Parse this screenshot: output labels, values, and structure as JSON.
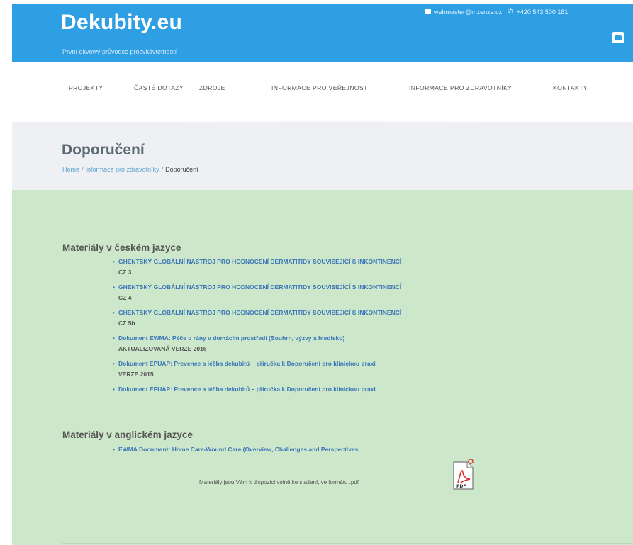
{
  "header": {
    "site_title": "Dekubity.eu",
    "tagline": "První dkvowý průvodce prosvkávtetnestí",
    "email": "webmaster@mzenze.cz",
    "phone": "+420 543 500 181"
  },
  "nav": {
    "items": [
      {
        "label": "PROJEKTY"
      },
      {
        "label": "ČASTÉ DOTAZY"
      },
      {
        "label": "ZDROJE"
      },
      {
        "label": "INFORMACE PRO VEŘEJNOST"
      },
      {
        "label": "INFORMACE PRO ZDRAVOTNÍKY"
      },
      {
        "label": "KONTAKTY"
      }
    ]
  },
  "title_band": {
    "page_title": "Doporučení",
    "breadcrumb": [
      {
        "label": "Home"
      },
      {
        "label": "Informace pro zdravotníky"
      },
      {
        "label": "Doporučení"
      }
    ],
    "separator": "/"
  },
  "content": {
    "czech_heading": "Materiály v českém jazyce",
    "czech_docs": [
      {
        "title": "GHENTSKÝ GLOBÁLNÍ NÁSTROJ PRO HODNOCENÍ DERMATITIDY SOUVISEJÍCÍ S INKONTINENCÍ",
        "note": "CZ 3"
      },
      {
        "title": "GHENTSKÝ GLOBÁLNÍ NÁSTROJ PRO HODNOCENÍ DERMATITIDY SOUVISEJÍCÍ S INKONTINENCÍ",
        "note": "CZ 4"
      },
      {
        "title": "GHENTSKÝ GLOBÁLNÍ NÁSTROJ PRO HODNOCENÍ DERMATITIDY SOUVISEJÍCÍ S INKONTINENCÍ",
        "note": "CZ 5b"
      },
      {
        "title": "Dokument EWMA: Péče o rány v domácím prostředí (Souhrn, výzvy a hledisko)",
        "note": "AKTUALIZOVANÁ VERZE 2016"
      },
      {
        "title": "Dokument EPUAP: Prevence a léčba dekubitů – příručka k Doporučení pro klinickou praxi",
        "note": "VERZE 2015"
      },
      {
        "title": "Dokument EPUAP: Prevence a léčba dekubitů – příručka k Doporučení pro klinickou praxi",
        "note": ""
      }
    ],
    "english_heading": "Materiály v anglickém jazyce",
    "english_docs": [
      {
        "title": "EWMA Document: Home Care-Wound Care (Overview, Challenges and Perspectives",
        "note": ""
      }
    ],
    "pdf_note": "Materiály jsou Vám k dispozici volně ke stažení, ve formátu .pdf",
    "pdf_icon_label": "PDF"
  },
  "colors": {
    "header_blue": "#2e9fe2",
    "content_green": "#cde7ca",
    "link_blue": "#3a75b8",
    "pdf_red": "#d8322b"
  }
}
